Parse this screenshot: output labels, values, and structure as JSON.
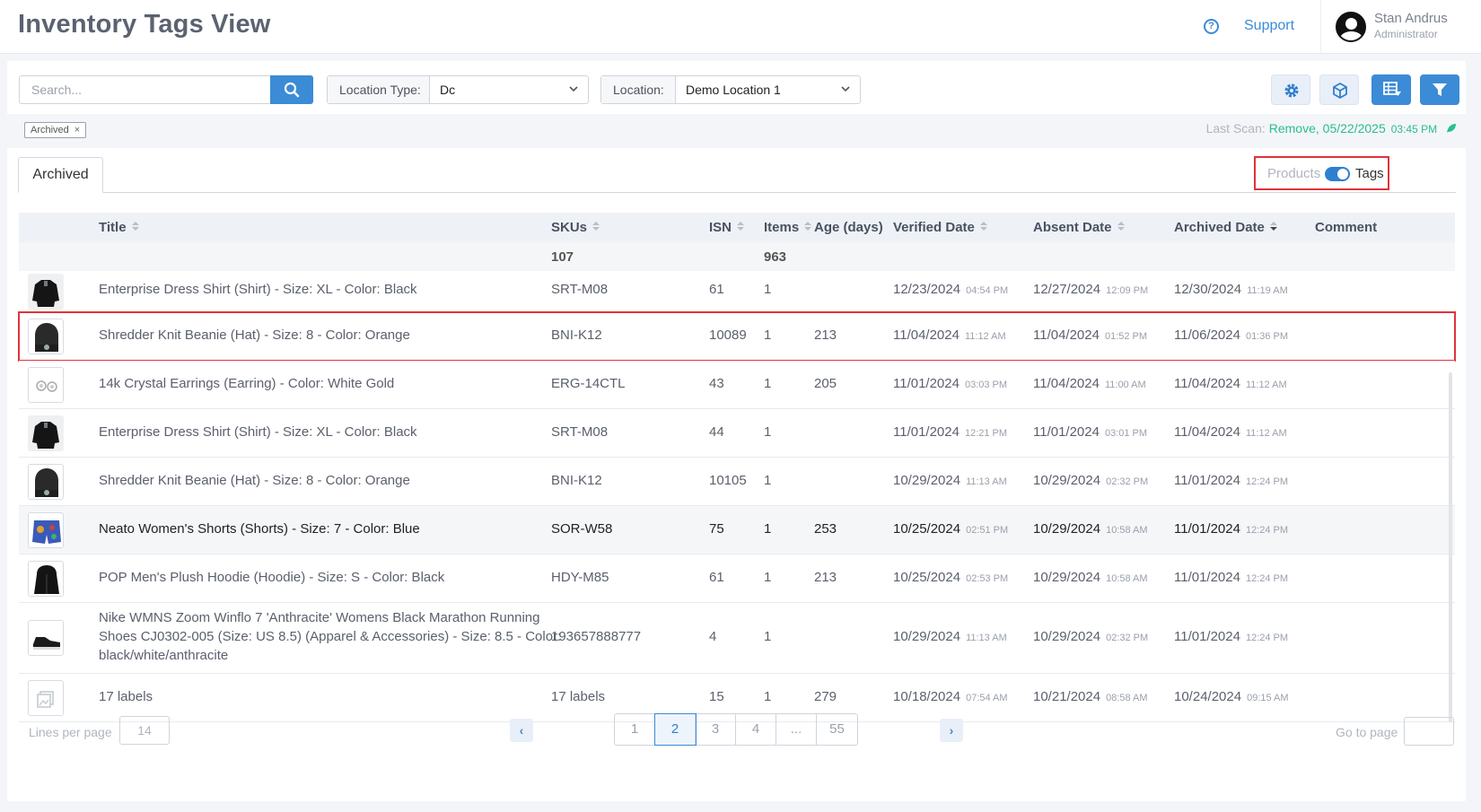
{
  "header": {
    "title": "Inventory Tags View",
    "support_label": "Support",
    "user_name": "Stan Andrus",
    "user_role": "Administrator"
  },
  "toolbar": {
    "search_placeholder": "Search...",
    "location_type_label": "Location Type:",
    "location_type_value": "Dc",
    "location_label": "Location:",
    "location_value": "Demo Location 1",
    "buttons": [
      "gear-icon",
      "cube-icon",
      "export-icon",
      "filter-icon"
    ]
  },
  "filters": {
    "chip_label": "Archived",
    "chip_close": "×",
    "last_scan_label": "Last Scan:",
    "last_scan_value": "Remove, 05/22/2025",
    "last_scan_time": "03:45 PM"
  },
  "tabs": {
    "active": "Archived"
  },
  "view_toggle": {
    "left_label": "Products",
    "right_label": "Tags",
    "state": "tags"
  },
  "table": {
    "columns": [
      "Title",
      "SKUs",
      "ISN",
      "Items",
      "Age (days)",
      "Verified Date",
      "Absent Date",
      "Archived Date",
      "Comment"
    ],
    "totals": {
      "skus": "107",
      "items": "963"
    },
    "rows": [
      {
        "title": "Enterprise Dress Shirt (Shirt) - Size: XL - Color: Black",
        "sku": "SRT-M08",
        "isn": "61",
        "items": "1",
        "age": "",
        "verified": "12/23/2024",
        "verified_time": "04:54 PM",
        "absent": "12/27/2024",
        "absent_time": "12:09 PM",
        "archived": "12/30/2024",
        "archived_time": "11:19 AM"
      },
      {
        "title": "Shredder Knit Beanie (Hat) - Size: 8 - Color: Orange",
        "sku": "BNI-K12",
        "isn": "10089",
        "items": "1",
        "age": "213",
        "verified": "11/04/2024",
        "verified_time": "11:12 AM",
        "absent": "11/04/2024",
        "absent_time": "01:52 PM",
        "archived": "11/06/2024",
        "archived_time": "01:36 PM"
      },
      {
        "title": "14k Crystal Earrings (Earring) - Color: White Gold",
        "sku": "ERG-14CTL",
        "isn": "43",
        "items": "1",
        "age": "205",
        "verified": "11/01/2024",
        "verified_time": "03:03 PM",
        "absent": "11/04/2024",
        "absent_time": "11:00 AM",
        "archived": "11/04/2024",
        "archived_time": "11:12 AM"
      },
      {
        "title": "Enterprise Dress Shirt (Shirt) - Size: XL - Color: Black",
        "sku": "SRT-M08",
        "isn": "44",
        "items": "1",
        "age": "",
        "verified": "11/01/2024",
        "verified_time": "12:21 PM",
        "absent": "11/01/2024",
        "absent_time": "03:01 PM",
        "archived": "11/04/2024",
        "archived_time": "11:12 AM"
      },
      {
        "title": "Shredder Knit Beanie (Hat) - Size: 8 - Color: Orange",
        "sku": "BNI-K12",
        "isn": "10105",
        "items": "1",
        "age": "",
        "verified": "10/29/2024",
        "verified_time": "11:13 AM",
        "absent": "10/29/2024",
        "absent_time": "02:32 PM",
        "archived": "11/01/2024",
        "archived_time": "12:24 PM"
      },
      {
        "title": "Neato Women's Shorts (Shorts) - Size: 7 - Color: Blue",
        "sku": "SOR-W58",
        "isn": "75",
        "items": "1",
        "age": "253",
        "verified": "10/25/2024",
        "verified_time": "02:51 PM",
        "absent": "10/29/2024",
        "absent_time": "10:58 AM",
        "archived": "11/01/2024",
        "archived_time": "12:24 PM"
      },
      {
        "title": "POP Men's Plush Hoodie (Hoodie) - Size: S - Color: Black",
        "sku": "HDY-M85",
        "isn": "61",
        "items": "1",
        "age": "213",
        "verified": "10/25/2024",
        "verified_time": "02:53 PM",
        "absent": "10/29/2024",
        "absent_time": "10:58 AM",
        "archived": "11/01/2024",
        "archived_time": "12:24 PM"
      },
      {
        "title_lines": [
          "Nike WMNS Zoom Winflo 7 'Anthracite' Womens Black Marathon Running",
          "Shoes CJ0302-005 (Size: US 8.5) (Apparel & Accessories) - Size: 8.5 - Color:",
          "black/white/anthracite"
        ],
        "sku": "193657888777",
        "isn": "4",
        "items": "1",
        "age": "",
        "verified": "10/29/2024",
        "verified_time": "11:13 AM",
        "absent": "10/29/2024",
        "absent_time": "02:32 PM",
        "archived": "11/01/2024",
        "archived_time": "12:24 PM"
      },
      {
        "title": "17 labels",
        "sku": "17 labels",
        "isn": "15",
        "items": "1",
        "age": "279",
        "verified": "10/18/2024",
        "verified_time": "07:54 AM",
        "absent": "10/21/2024",
        "absent_time": "08:58 AM",
        "archived": "10/24/2024",
        "archived_time": "09:15 AM"
      }
    ]
  },
  "pagination": {
    "lines_per_page_label": "Lines per page",
    "lines_per_page_value": "14",
    "pages": [
      "1",
      "2",
      "3",
      "4",
      "...",
      "55"
    ],
    "current_page": "2",
    "prev": "‹",
    "next": "›",
    "goto_label": "Go to page"
  },
  "colors": {
    "accent": "#3b8bd6",
    "highlight": "#e0333a",
    "success": "#27c08a"
  }
}
